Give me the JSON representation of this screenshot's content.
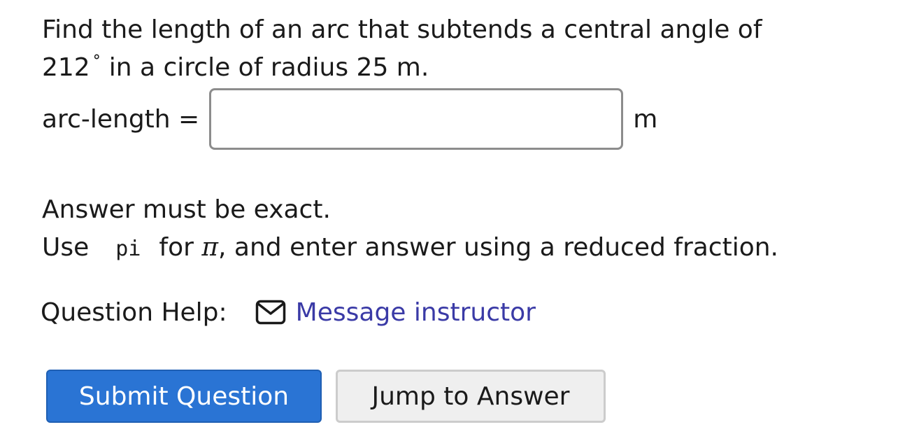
{
  "question": {
    "line1": "Find the length of an arc that subtends a central angle of",
    "angle": "212",
    "degree_symbol": "°",
    "line2_rest": "in a circle of radius 25 m."
  },
  "answer": {
    "label": "arc-length =",
    "value": "",
    "unit": "m"
  },
  "notes": {
    "exact": "Answer must be exact.",
    "use_prefix": "Use",
    "pi_code": "pi",
    "for_text": "for",
    "pi_symbol": "π",
    "suffix": ", and enter answer using a reduced fraction."
  },
  "help": {
    "label": "Question Help:",
    "icon": "envelope-icon",
    "link": "Message instructor"
  },
  "buttons": {
    "submit": "Submit Question",
    "jump": "Jump to Answer"
  },
  "colors": {
    "link": "#3a3aa6",
    "submit_bg": "#2a74d4",
    "jump_bg": "#efefef"
  }
}
